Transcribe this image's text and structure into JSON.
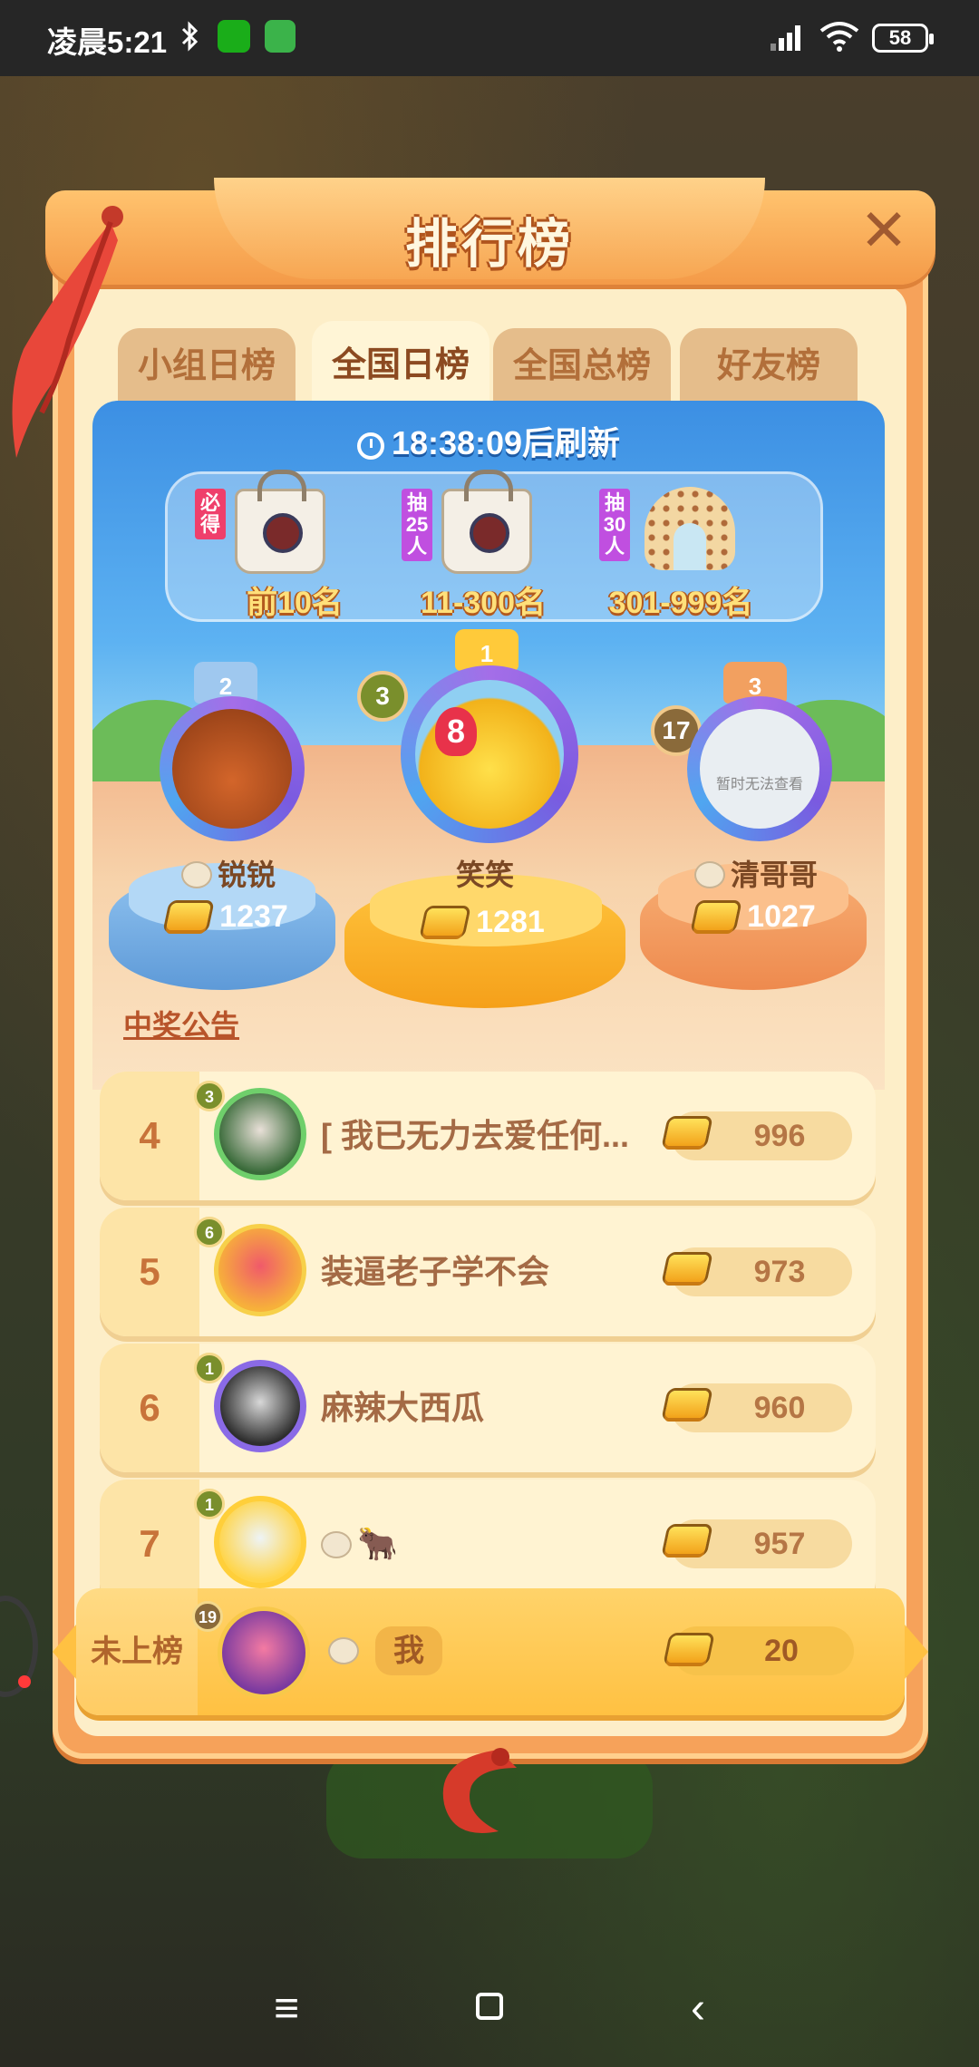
{
  "status_bar": {
    "time": "凌晨5:21",
    "battery": "58",
    "icons": [
      "bluetooth-icon",
      "wechat-icon",
      "app-icon",
      "signal-icon",
      "wifi-icon",
      "battery-icon"
    ]
  },
  "panel": {
    "title": "排行榜",
    "close_icon": "close-icon"
  },
  "tabs": [
    {
      "label": "小组日榜",
      "active": false
    },
    {
      "label": "全国日榜",
      "active": true
    },
    {
      "label": "全国总榜",
      "active": false
    },
    {
      "label": "好友榜",
      "active": false
    }
  ],
  "stage": {
    "refresh_text": "18:38:09后刷新",
    "rewards": [
      {
        "tag": "必得",
        "label": "前10名",
        "item": "bag"
      },
      {
        "tag": "抽25人",
        "label": "11-300名",
        "item": "bag"
      },
      {
        "tag": "抽30人",
        "label": "301-999名",
        "item": "pillow"
      }
    ]
  },
  "podium": [
    {
      "place": "2",
      "name": "锐锐",
      "score": "1237",
      "level": ""
    },
    {
      "place": "1",
      "name": "笑笑",
      "score": "1281",
      "level": "3",
      "avatar_badge": "8"
    },
    {
      "place": "3",
      "name": "清哥哥",
      "score": "1027",
      "level": "17",
      "avatar_note": "暂时无法查看"
    }
  ],
  "announcement": "中奖公告",
  "rankings": [
    {
      "rank": "4",
      "name": "[ 我已无力去爱任何...",
      "score": "996",
      "level": "3"
    },
    {
      "rank": "5",
      "name": "装逼老子学不会",
      "score": "973",
      "level": "6"
    },
    {
      "rank": "6",
      "name": "麻辣大西瓜",
      "score": "960",
      "level": "1"
    },
    {
      "rank": "7",
      "name": "🐂",
      "score": "957",
      "level": "1"
    }
  ],
  "my_row": {
    "rank_label": "未上榜",
    "level": "19",
    "name": "我",
    "score": "20"
  },
  "colors": {
    "panel_orange": "#f6a25a",
    "panel_inner": "#fdeec8",
    "tab_active": "#fff5d6",
    "gold": "#ffc142"
  }
}
